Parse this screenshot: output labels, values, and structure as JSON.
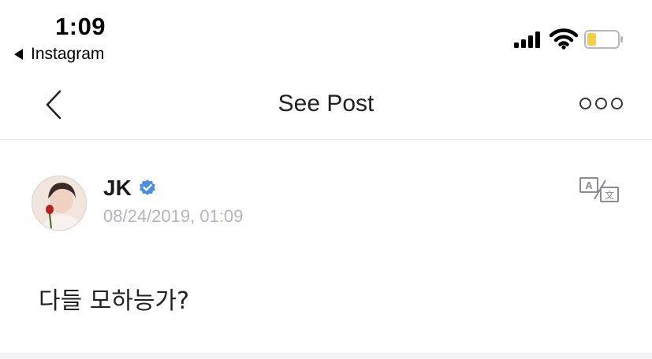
{
  "status_bar": {
    "time": "1:09",
    "back_app_label": "Instagram",
    "signal_icon": "cellular-signal-icon",
    "wifi_icon": "wifi-icon",
    "battery_icon": "battery-icon",
    "battery_level": 0.3,
    "battery_color": "#f5cf3d"
  },
  "nav": {
    "back_icon": "chevron-left-icon",
    "title": "See Post",
    "more_icon": "more-options-icon"
  },
  "post": {
    "author": "JK",
    "verified_icon": "verified-badge-icon",
    "verified_color": "#4a90e2",
    "timestamp": "08/24/2019, 01:09",
    "translate_icon": "translate-icon",
    "text": "다들 모하능가?"
  }
}
